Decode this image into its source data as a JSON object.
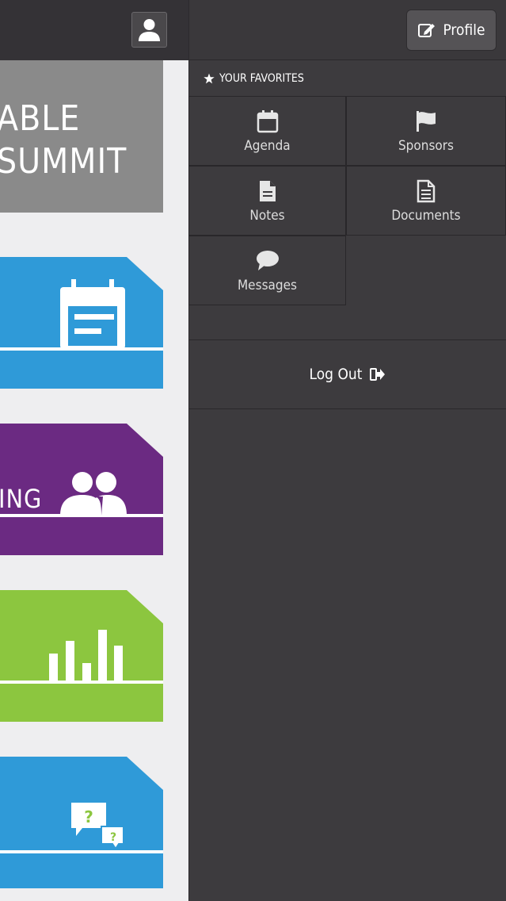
{
  "left_panel": {
    "banner_lines": [
      "ABLE",
      "SUMMIT"
    ],
    "tiles": [
      {
        "color": "#2f9ad8",
        "icon": "calendar-icon",
        "label": ""
      },
      {
        "color": "#6b2a82",
        "icon": "people-icon",
        "label": "ING"
      },
      {
        "color": "#8cc63f",
        "icon": "bar-chart-icon",
        "label": ""
      },
      {
        "color": "#2f9ad8",
        "icon": "question-bubbles-icon",
        "label": ""
      }
    ]
  },
  "header": {
    "profile_label": "Profile"
  },
  "favorites": {
    "title": "YOUR FAVORITES",
    "items": [
      {
        "label": "Agenda",
        "icon": "calendar-icon"
      },
      {
        "label": "Sponsors",
        "icon": "flag-icon"
      },
      {
        "label": "Notes",
        "icon": "note-icon"
      },
      {
        "label": "Documents",
        "icon": "document-icon"
      },
      {
        "label": "Messages",
        "icon": "chat-bubble-icon"
      }
    ]
  },
  "logout_label": "Log Out",
  "colors": {
    "menu_bg": "#3d3b3e",
    "blue": "#2f9ad8",
    "purple": "#6b2a82",
    "green": "#8cc63f"
  }
}
